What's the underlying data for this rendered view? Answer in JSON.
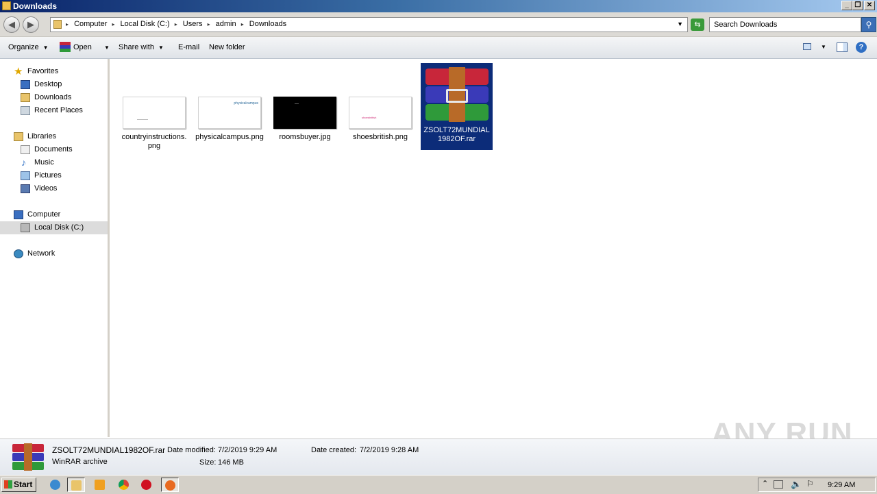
{
  "window": {
    "title": "Downloads"
  },
  "address": {
    "crumbs": [
      "Computer",
      "Local Disk (C:)",
      "Users",
      "admin",
      "Downloads"
    ]
  },
  "search": {
    "placeholder": "Search Downloads"
  },
  "toolbar": {
    "organize": "Organize",
    "open": "Open",
    "share_with": "Share with",
    "email": "E-mail",
    "new_folder": "New folder"
  },
  "nav": {
    "favorites": "Favorites",
    "desktop": "Desktop",
    "downloads": "Downloads",
    "recent_places": "Recent Places",
    "libraries": "Libraries",
    "documents": "Documents",
    "music": "Music",
    "pictures": "Pictures",
    "videos": "Videos",
    "computer": "Computer",
    "local_disk": "Local Disk (C:)",
    "network": "Network"
  },
  "files": [
    {
      "name": "countryinstructions.png"
    },
    {
      "name": "physicalcampus.png",
      "thumb_text": "physicalcampus"
    },
    {
      "name": "roomsbuyer.jpg"
    },
    {
      "name": "shoesbritish.png",
      "thumb_text": "shoesbritish"
    },
    {
      "name": "ZSOLT72MUNDIAL1982OF.rar",
      "selected": true
    }
  ],
  "details": {
    "name": "ZSOLT72MUNDIAL1982OF.rar",
    "type": "WinRAR archive",
    "modified_label": "Date modified:",
    "modified_value": "7/2/2019 9:29 AM",
    "created_label": "Date created:",
    "created_value": "7/2/2019 9:28 AM",
    "size_label": "Size:",
    "size_value": "146 MB"
  },
  "taskbar": {
    "start": "Start",
    "clock": "9:29 AM"
  },
  "watermark": "ANY RUN",
  "colors": {
    "selection": "#0c2c79",
    "titlebar": "#0a246a",
    "rar_red": "#c8263a",
    "rar_blue": "#3a3ab8",
    "rar_green": "#2f9a3a"
  }
}
